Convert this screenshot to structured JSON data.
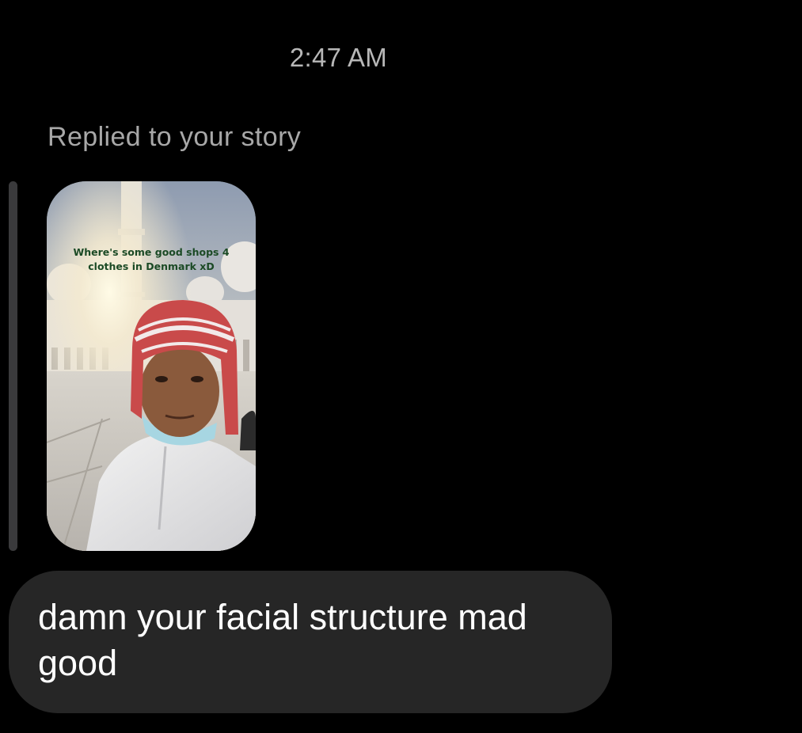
{
  "conversation": {
    "timestamp": "2:47 AM",
    "reply_label": "Replied to your story",
    "story": {
      "caption": "Where's some good shops 4 clothes in Denmark xD"
    },
    "message": {
      "text": "damn your facial structure mad good"
    }
  },
  "colors": {
    "background": "#000000",
    "bubble": "#262626",
    "reply_bar": "#3a3a3c",
    "timestamp_text": "#b7b7b7",
    "message_text": "#ffffff"
  },
  "icons": {
    "story_thumbnail": "photo-story-thumbnail"
  }
}
